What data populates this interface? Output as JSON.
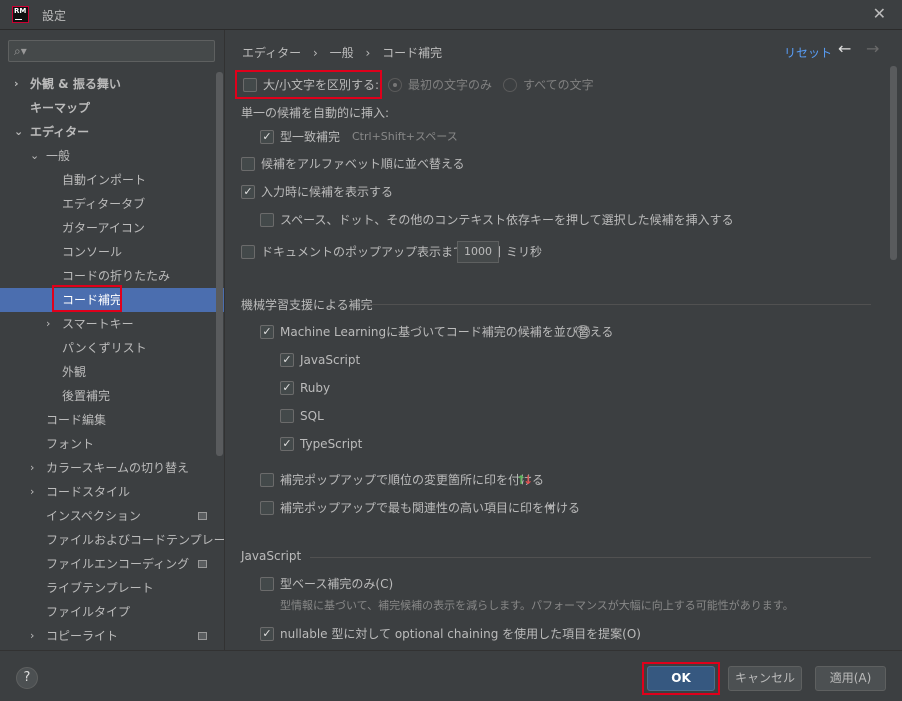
{
  "window": {
    "title": "設定",
    "logo": "RM"
  },
  "search": {
    "placeholder": "",
    "value": ""
  },
  "tree": {
    "items": [
      {
        "label": "外観 & 振る舞い"
      },
      {
        "label": "キーマップ"
      },
      {
        "label": "エディター"
      },
      {
        "label": "一般"
      },
      {
        "label": "自動インポート"
      },
      {
        "label": "エディタータブ"
      },
      {
        "label": "ガターアイコン"
      },
      {
        "label": "コンソール"
      },
      {
        "label": "コードの折りたたみ"
      },
      {
        "label": "コード補完"
      },
      {
        "label": "スマートキー"
      },
      {
        "label": "パンくずリスト"
      },
      {
        "label": "外観"
      },
      {
        "label": "後置補完"
      },
      {
        "label": "コード編集"
      },
      {
        "label": "フォント"
      },
      {
        "label": "カラースキームの切り替え"
      },
      {
        "label": "コードスタイル"
      },
      {
        "label": "インスペクション"
      },
      {
        "label": "ファイルおよびコードテンプレート"
      },
      {
        "label": "ファイルエンコーディング"
      },
      {
        "label": "ライブテンプレート"
      },
      {
        "label": "ファイルタイプ"
      },
      {
        "label": "コピーライト"
      }
    ]
  },
  "breadcrumb": {
    "part1": "エディター",
    "part2": "一般",
    "part3": "コード補完",
    "sep": "›"
  },
  "header": {
    "reset": "リセット",
    "back": "←",
    "forward": "→"
  },
  "settings": {
    "case_sensitive": "大/小文字を区別する:",
    "first_letter_only": "最初の文字のみ",
    "all_letters": "すべての文字",
    "auto_insert_header": "単一の候補を自動的に挿入:",
    "basic_completion": "型一致補完",
    "basic_shortcut": "Ctrl+Shift+スペース",
    "sort_alpha": "候補をアルファベット順に並べ替える",
    "show_on_typing": "入力時に候補を表示する",
    "insert_on_space": "スペース、ドット、その他のコンテキスト依存キーを押して選択した候補を挿入する",
    "doc_popup": "ドキュメントのポップアップ表示までの時間",
    "doc_popup_ms": "1000",
    "doc_popup_unit": "ミリ秒",
    "ml_section": "機械学習支援による補完",
    "ml_sort": "Machine Learningに基づいてコード補完の候補を並び替える",
    "ml_help": "?",
    "lang_js": "JavaScript",
    "lang_ruby": "Ruby",
    "lang_sql": "SQL",
    "lang_ts": "TypeScript",
    "mark_position": "補完ポップアップで順位の変更箇所に印を付ける",
    "mark_relevant": "補完ポップアップで最も関連性の高い項目に印を付ける",
    "js_section": "JavaScript",
    "type_based": "型ベース補完のみ(C)",
    "type_based_hint": "型情報に基づいて、補完候補の表示を減らします。パフォーマンスが大幅に向上する可能性があります。",
    "optional_chaining": "nullable 型に対して optional chaining を使用した項目を提案(O)"
  },
  "buttons": {
    "help": "?",
    "ok": "OK",
    "cancel": "キャンセル",
    "apply": "適用(A)"
  },
  "colors": {
    "accent": "#4b6eaf",
    "highlight": "#e0001b",
    "link": "#589df6",
    "up_arrow": "#5fb85f",
    "down_arrow": "#e05050"
  }
}
